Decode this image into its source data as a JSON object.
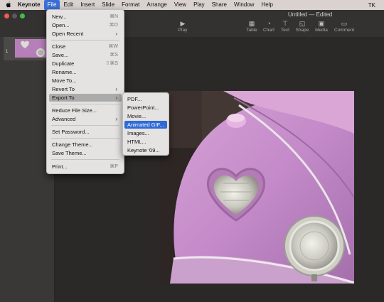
{
  "menubar": {
    "apple": "",
    "app": "Keynote",
    "items": [
      "File",
      "Edit",
      "Insert",
      "Slide",
      "Format",
      "Arrange",
      "View",
      "Play",
      "Share",
      "Window",
      "Help"
    ],
    "user": "TK"
  },
  "toolbar": {
    "doc_title": "Untitled — Edited",
    "play": "Play",
    "items": [
      "Table",
      "Chart",
      "Text",
      "Shape",
      "Media",
      "Comment"
    ]
  },
  "sidebar": {
    "slide_number": "1"
  },
  "file_menu": {
    "items": [
      {
        "label": "New...",
        "shortcut": "⌘N"
      },
      {
        "label": "Open...",
        "shortcut": "⌘O"
      },
      {
        "label": "Open Recent",
        "submenu": true
      },
      {
        "label": "Close",
        "shortcut": "⌘W"
      },
      {
        "label": "Save...",
        "shortcut": "⌘S"
      },
      {
        "label": "Duplicate",
        "shortcut": "⇧⌘S"
      },
      {
        "label": "Rename..."
      },
      {
        "label": "Move To..."
      },
      {
        "label": "Revert To",
        "submenu": true
      },
      {
        "label": "Export To",
        "submenu": true,
        "highlighted": true
      },
      {
        "label": "Reduce File Size..."
      },
      {
        "label": "Advanced",
        "submenu": true
      },
      {
        "label": "Set Password..."
      },
      {
        "label": "Change Theme..."
      },
      {
        "label": "Save Theme..."
      },
      {
        "label": "Print...",
        "shortcut": "⌘P"
      }
    ]
  },
  "export_menu": {
    "items": [
      {
        "label": "PDF..."
      },
      {
        "label": "PowerPoint..."
      },
      {
        "label": "Movie..."
      },
      {
        "label": "Animated GIF...",
        "selected": true
      },
      {
        "label": "Images..."
      },
      {
        "label": "HTML..."
      },
      {
        "label": "Keynote '09..."
      }
    ]
  },
  "icons": {
    "apple": "apple-logo-icon",
    "play": "play-icon",
    "table": "table-icon",
    "chart": "chart-icon",
    "text": "text-icon",
    "shape": "shape-icon",
    "media": "media-icon",
    "comment": "comment-icon",
    "submenu": "chevron-right-icon"
  },
  "colors": {
    "menu_selection": "#2f6ad6",
    "menu_highlight": "#ababab",
    "slide_car": "#c48ac9"
  }
}
